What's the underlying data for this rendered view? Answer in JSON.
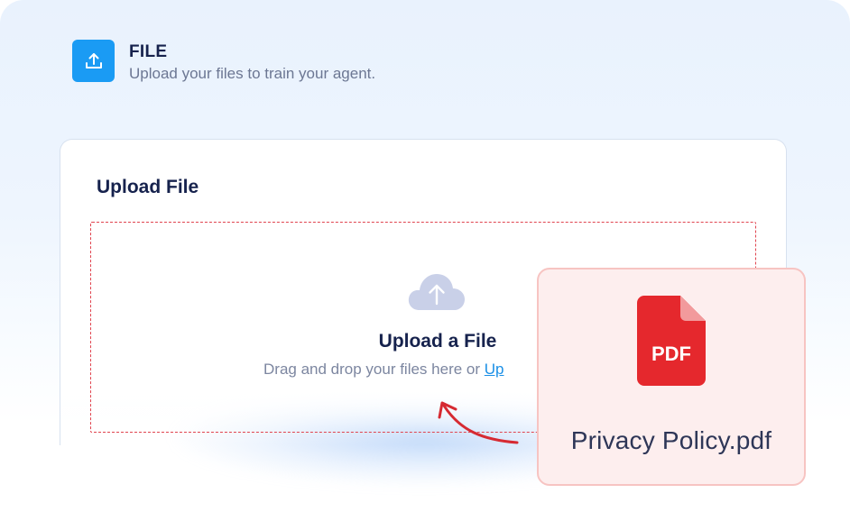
{
  "header": {
    "icon": "upload-tray-icon",
    "title": "FILE",
    "subtitle": "Upload your files to train your agent."
  },
  "card": {
    "title": "Upload File",
    "dropzone": {
      "icon": "cloud-upload-icon",
      "title": "Upload a File",
      "text": "Drag and drop your files here or ",
      "link_label": "Up"
    }
  },
  "file": {
    "icon": "pdf-file-icon",
    "badge": "PDF",
    "name": "Privacy Policy.pdf"
  },
  "colors": {
    "accent": "#1a9bf4",
    "dash": "#e0434e",
    "pdf_red": "#e5282d",
    "pdf_card_bg": "#fdeeee",
    "heading": "#16224d"
  }
}
